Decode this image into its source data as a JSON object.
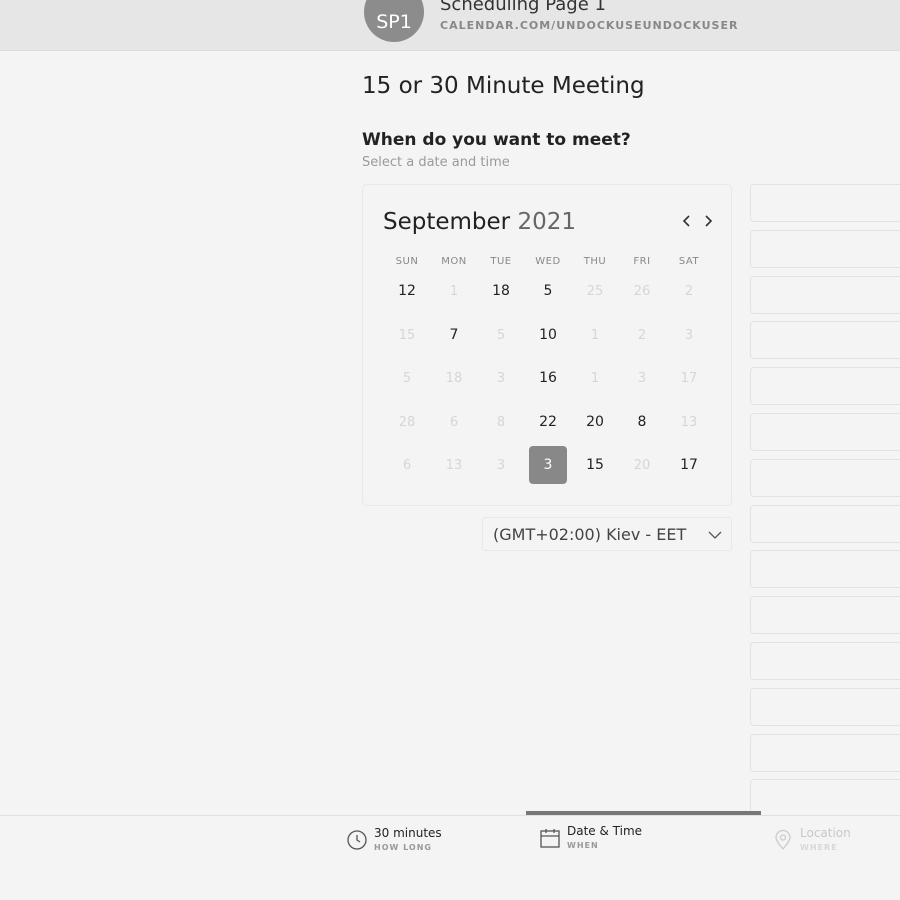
{
  "header": {
    "avatar_initials": "SP1",
    "page_name": "Scheduling Page 1",
    "page_url": "CALENDAR.COM/UNDOCKUSEUNDOCKUSER"
  },
  "meeting_title": "15 or 30 Minute Meeting",
  "question": "When do you want to meet?",
  "subtitle": "Select a date and time",
  "calendar": {
    "month": "September",
    "year": "2021",
    "weekdays": [
      "SUN",
      "MON",
      "TUE",
      "WED",
      "THU",
      "FRI",
      "SAT"
    ],
    "weeks": [
      [
        {
          "d": "12",
          "on": true
        },
        {
          "d": "1",
          "on": false
        },
        {
          "d": "18",
          "on": true
        },
        {
          "d": "5",
          "on": true
        },
        {
          "d": "25",
          "on": false
        },
        {
          "d": "26",
          "on": false
        },
        {
          "d": "2",
          "on": false
        }
      ],
      [
        {
          "d": "15",
          "on": false
        },
        {
          "d": "7",
          "on": true
        },
        {
          "d": "5",
          "on": false
        },
        {
          "d": "10",
          "on": true
        },
        {
          "d": "1",
          "on": false
        },
        {
          "d": "2",
          "on": false
        },
        {
          "d": "3",
          "on": false
        }
      ],
      [
        {
          "d": "5",
          "on": false
        },
        {
          "d": "18",
          "on": false
        },
        {
          "d": "3",
          "on": false
        },
        {
          "d": "16",
          "on": true
        },
        {
          "d": "1",
          "on": false
        },
        {
          "d": "3",
          "on": false
        },
        {
          "d": "17",
          "on": false
        }
      ],
      [
        {
          "d": "28",
          "on": false
        },
        {
          "d": "6",
          "on": false
        },
        {
          "d": "8",
          "on": false
        },
        {
          "d": "22",
          "on": true
        },
        {
          "d": "20",
          "on": true
        },
        {
          "d": "8",
          "on": true
        },
        {
          "d": "13",
          "on": false
        }
      ],
      [
        {
          "d": "6",
          "on": false
        },
        {
          "d": "13",
          "on": false
        },
        {
          "d": "3",
          "on": false
        },
        {
          "d": "3",
          "on": true,
          "selected": true
        },
        {
          "d": "15",
          "on": true
        },
        {
          "d": "20",
          "on": false
        },
        {
          "d": "17",
          "on": true
        }
      ]
    ],
    "prev_icon": "chevron-left-icon",
    "next_icon": "chevron-right-icon"
  },
  "timezone": {
    "value": "(GMT+02:00) Kiev - EET",
    "icon": "chevron-down-icon"
  },
  "time_slots_count": 14,
  "steps": [
    {
      "label": "30 minutes",
      "caption": "HOW LONG",
      "icon": "clock-icon",
      "active": false,
      "enabled": true
    },
    {
      "label": "Date & Time",
      "caption": "WHEN",
      "icon": "calendar-icon",
      "active": true,
      "enabled": true
    },
    {
      "label": "Location",
      "caption": "WHERE",
      "icon": "location-pin-icon",
      "active": false,
      "enabled": false
    }
  ],
  "colors": {
    "selected_day": "#888888",
    "background": "#f4f4f4",
    "header": "#e6e6e6"
  }
}
